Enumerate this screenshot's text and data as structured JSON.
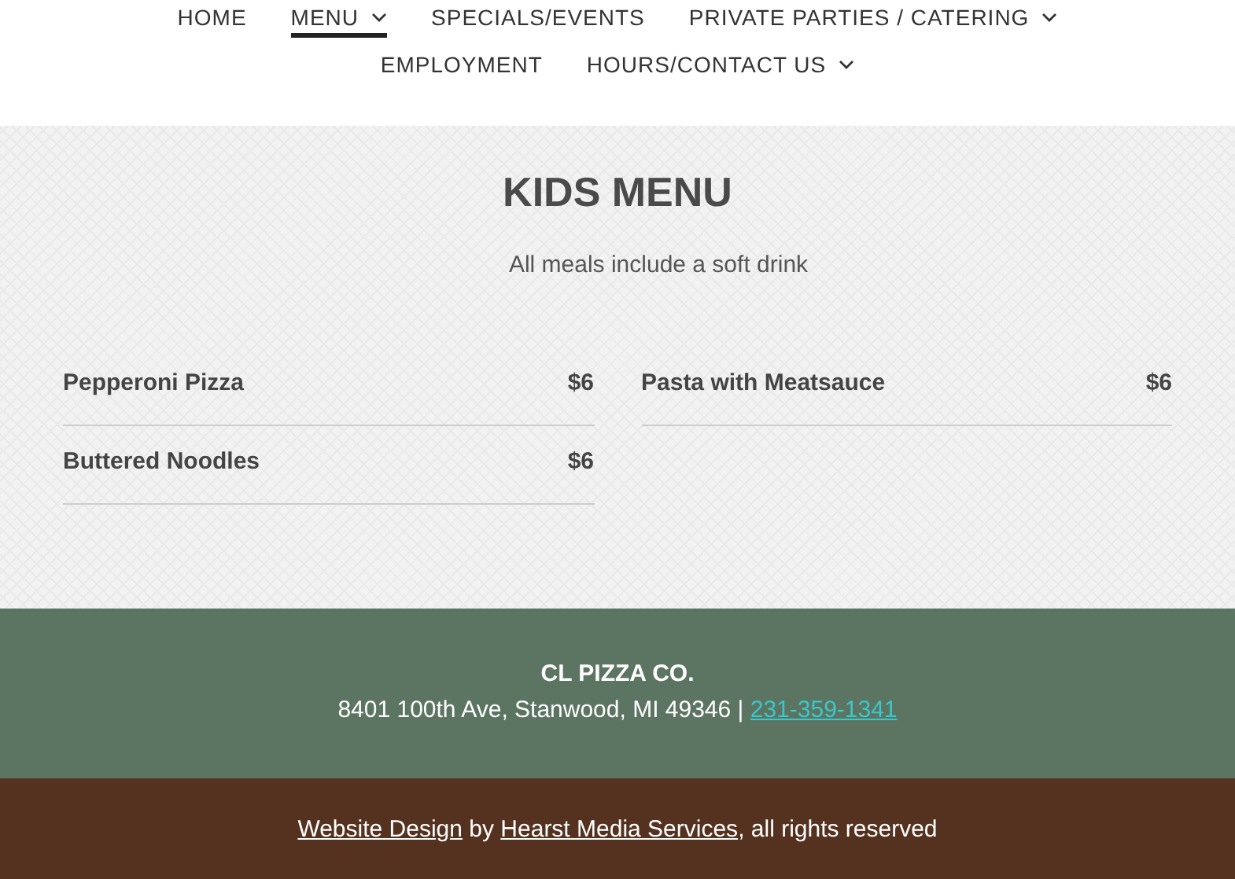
{
  "nav": {
    "items": [
      {
        "label": "HOME",
        "selected": false,
        "dropdown": false
      },
      {
        "label": "MENU",
        "selected": true,
        "dropdown": true
      },
      {
        "label": "SPECIALS/EVENTS",
        "selected": false,
        "dropdown": false
      },
      {
        "label": "PRIVATE PARTIES / CATERING",
        "selected": false,
        "dropdown": true
      },
      {
        "label": "EMPLOYMENT",
        "selected": false,
        "dropdown": false
      },
      {
        "label": "HOURS/CONTACT US",
        "selected": false,
        "dropdown": true
      }
    ]
  },
  "section": {
    "title": "KIDS MENU",
    "subtitle": "All meals include a soft drink",
    "columns": [
      [
        {
          "name": "Pepperoni Pizza",
          "price": "$6"
        },
        {
          "name": "Buttered Noodles",
          "price": "$6"
        }
      ],
      [
        {
          "name": "Pasta with Meatsauce",
          "price": "$6"
        }
      ]
    ]
  },
  "footer": {
    "name": "CL PIZZA CO.",
    "address": "8401 100th Ave, Stanwood, MI 49346 |",
    "phone": "231-359-1341"
  },
  "credits": {
    "link_1": "Website Design",
    "text_1": " by ",
    "link_2": "Hearst Media Services",
    "text_2": ", all rights reserved"
  }
}
